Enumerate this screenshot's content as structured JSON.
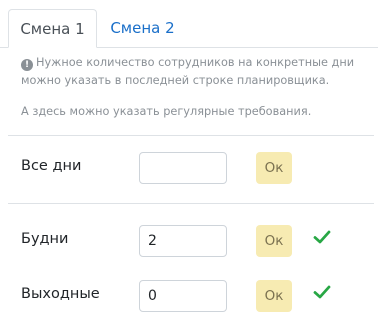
{
  "tabs": [
    {
      "label": "Смена 1",
      "active": true
    },
    {
      "label": "Смена 2",
      "active": false
    }
  ],
  "hint": {
    "icon": "info-icon",
    "text": "Нужное количество сотрудников на конкретные дни можно указать в последней строке планировщика.",
    "regular_text": "А здесь можно указать регулярные требования."
  },
  "rows": [
    {
      "label": "Все дни",
      "value": "",
      "button": "Ок",
      "saved": false
    },
    {
      "label": "Будни",
      "value": "2",
      "button": "Ок",
      "saved": true
    },
    {
      "label": "Выходные",
      "value": "0",
      "button": "Ок",
      "saved": true
    }
  ],
  "colors": {
    "accent": "#1a6fc9",
    "ok_button": "#f7ebb2",
    "check": "#28a745"
  }
}
